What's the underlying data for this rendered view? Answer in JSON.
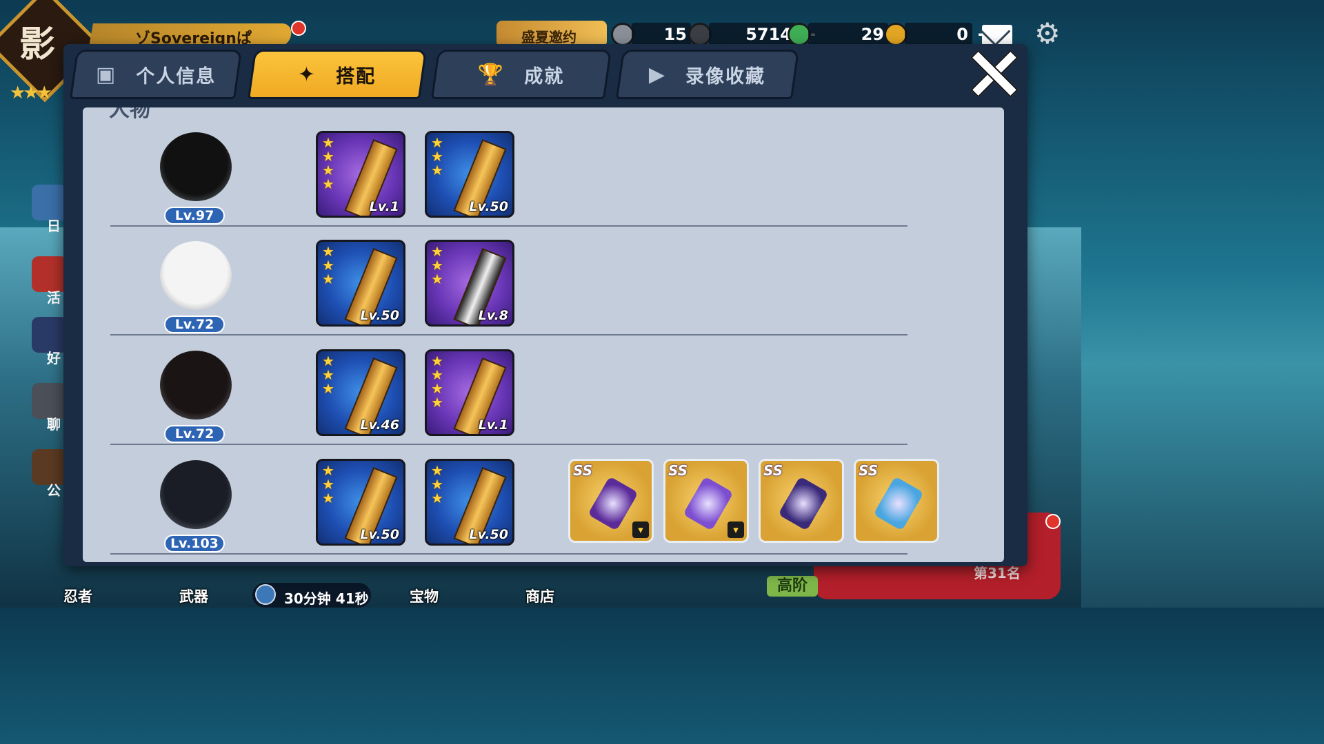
{
  "header": {
    "player_name": "ゾSovereignぱ",
    "emblem_char": "影",
    "emblem_stars": "★★★",
    "event_label": "盛夏邀约",
    "resources": [
      {
        "name": "scroll",
        "value": "15",
        "color": "#8a8f98"
      },
      {
        "name": "coin",
        "value": "5714",
        "color": "#3b3f45"
      },
      {
        "name": "green-orb",
        "value": "29",
        "color": "#3fae55"
      },
      {
        "name": "gold-key",
        "value": "0",
        "color": "#e2a623"
      }
    ],
    "plus": "+"
  },
  "left_sidebar": [
    "日",
    "活",
    "好",
    "聊",
    "公"
  ],
  "bottom_nav": {
    "items": [
      "忍者",
      "武器",
      "宝物",
      "商店"
    ],
    "timer": "30分钟 41秒",
    "tier": "高阶",
    "rank": "第31名"
  },
  "modal": {
    "tabs": [
      {
        "label": "个人信息",
        "icon": "person-card-icon",
        "active": false
      },
      {
        "label": "搭配",
        "icon": "shuriken-icon",
        "active": true
      },
      {
        "label": "成就",
        "icon": "trophy-icon",
        "active": false
      },
      {
        "label": "录像收藏",
        "icon": "play-icon",
        "active": false
      }
    ],
    "section_title": "人物",
    "rows": [
      {
        "level": "Lv.97",
        "head_color": "#111111",
        "weapons": [
          {
            "stars": [
              "★",
              "★",
              "★",
              "★"
            ],
            "level": "Lv.1",
            "bg": "purple",
            "blade": "gold"
          },
          {
            "stars": [
              "★",
              "★",
              "★"
            ],
            "level": "Lv.50",
            "bg": "blue",
            "blade": "gold"
          }
        ]
      },
      {
        "level": "Lv.72",
        "head_color": "#f4f4f4",
        "weapons": [
          {
            "stars": [
              "★",
              "★",
              "★"
            ],
            "level": "Lv.50",
            "bg": "blue",
            "blade": "gold"
          },
          {
            "stars": [
              "★",
              "★",
              "★"
            ],
            "level": "Lv.8",
            "bg": "purple",
            "blade": "dark"
          }
        ]
      },
      {
        "level": "Lv.72",
        "head_color": "#1b1414",
        "weapons": [
          {
            "stars": [
              "★",
              "★",
              "★"
            ],
            "level": "Lv.46",
            "bg": "blue",
            "blade": "gold"
          },
          {
            "stars": [
              "★",
              "★",
              "★",
              "★"
            ],
            "level": "Lv.1",
            "bg": "purple",
            "blade": "gold"
          }
        ]
      },
      {
        "level": "Lv.103",
        "head_color": "#1a1d26",
        "weapons": [
          {
            "stars": [
              "★",
              "★",
              "★"
            ],
            "level": "Lv.50",
            "bg": "blue",
            "blade": "gold"
          },
          {
            "stars": [
              "★",
              "★",
              "★"
            ],
            "level": "Lv.50",
            "bg": "blue",
            "blade": "gold"
          }
        ],
        "treasures": [
          {
            "grade": "SS",
            "art_color": "#5b2b9a",
            "badge": "shirt"
          },
          {
            "grade": "SS",
            "art_color": "#7d4fd0",
            "badge": "shirt"
          },
          {
            "grade": "SS",
            "art_color": "#3a2a7a",
            "badge": ""
          },
          {
            "grade": "SS",
            "art_color": "#4aa6e0",
            "badge": ""
          }
        ]
      }
    ]
  }
}
